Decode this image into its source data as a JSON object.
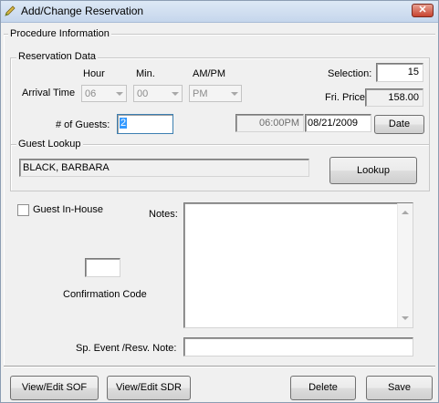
{
  "window": {
    "title": "Add/Change Reservation",
    "close_label": "✕"
  },
  "procedure": {
    "caption": "Procedure Information"
  },
  "reservation": {
    "caption": "Reservation Data",
    "col_hour": "Hour",
    "col_min": "Min.",
    "col_ampm": "AM/PM",
    "arrival_time_label": "Arrival Time",
    "hour_value": "06",
    "min_value": "00",
    "ampm_value": "PM",
    "selection_label": "Selection:",
    "selection_value": "15",
    "fri_price_label": "Fri. Price",
    "fri_price_value": "158.00",
    "guests_label": "# of Guests:",
    "guests_value": "2",
    "time_value": "06:00PM",
    "date_value": "08/21/2009",
    "date_button": "Date"
  },
  "guest_lookup": {
    "caption": "Guest Lookup",
    "name_value": "BLACK, BARBARA",
    "lookup_button": "Lookup"
  },
  "details": {
    "guest_inhouse_label": "Guest In-House",
    "notes_label": "Notes:",
    "notes_value": "",
    "confirmation_label": "Confirmation Code",
    "confirmation_value": "",
    "sp_event_label": "Sp. Event /Resv. Note:",
    "sp_event_value": ""
  },
  "footer": {
    "view_sof": "View/Edit SOF",
    "view_sdr": "View/Edit SDR",
    "delete": "Delete",
    "save": "Save"
  }
}
